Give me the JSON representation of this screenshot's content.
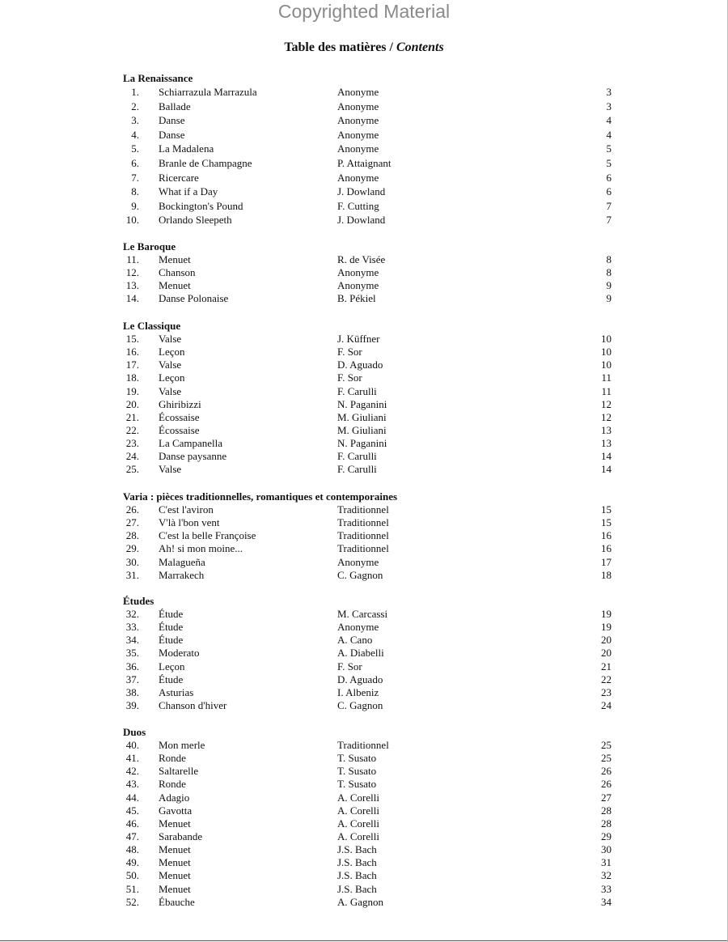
{
  "watermark": "Copyrighted Material",
  "title": {
    "main": "Table des matières / ",
    "italic": "Contents"
  },
  "sections": [
    {
      "heading": "La Renaissance",
      "items": [
        [
          "1.",
          "Schiarrazula Marrazula",
          "Anonyme",
          "3"
        ],
        [
          "2.",
          "Ballade",
          "Anonyme",
          "3"
        ],
        [
          "3.",
          "Danse",
          "Anonyme",
          "4"
        ],
        [
          "4.",
          "Danse",
          "Anonyme",
          "4"
        ],
        [
          "5.",
          "La Madalena",
          "Anonyme",
          "5"
        ],
        [
          "6.",
          "Branle de Champagne",
          "P. Attaignant",
          "5"
        ],
        [
          "7.",
          "Ricercare",
          "Anonyme",
          "6"
        ],
        [
          "8.",
          "What if a Day",
          "J. Dowland",
          "6"
        ],
        [
          "9.",
          "Bockington's Pound",
          "F. Cutting",
          "7"
        ],
        [
          "10.",
          "Orlando Sleepeth",
          "J. Dowland",
          "7"
        ]
      ]
    },
    {
      "heading": "Le Baroque",
      "items": [
        [
          "11.",
          "Menuet",
          "R. de Visée",
          "8"
        ],
        [
          "12.",
          "Chanson",
          "Anonyme",
          "8"
        ],
        [
          "13.",
          "Menuet",
          "Anonyme",
          "9"
        ],
        [
          "14.",
          "Danse Polonaise",
          "B. Pékiel",
          "9"
        ]
      ]
    },
    {
      "heading": "Le Classique",
      "items": [
        [
          "15.",
          "Valse",
          "J. Küffner",
          "10"
        ],
        [
          "16.",
          "Leçon",
          "F. Sor",
          "10"
        ],
        [
          "17.",
          "Valse",
          "D. Aguado",
          "10"
        ],
        [
          "18.",
          "Leçon",
          "F. Sor",
          "11"
        ],
        [
          "19.",
          "Valse",
          "F. Carulli",
          "11"
        ],
        [
          "20.",
          "Ghiribizzi",
          "N. Paganini",
          "12"
        ],
        [
          "21.",
          "Écossaise",
          "M. Giuliani",
          "12"
        ],
        [
          "22.",
          "Écossaise",
          "M. Giuliani",
          "13"
        ],
        [
          "23.",
          "La Campanella",
          "N. Paganini",
          "13"
        ],
        [
          "24.",
          "Danse paysanne",
          "F. Carulli",
          "14"
        ],
        [
          "25.",
          "Valse",
          "F. Carulli",
          "14"
        ]
      ]
    },
    {
      "heading": "Varia : pièces traditionnelles, romantiques et contemporaines",
      "items": [
        [
          "26.",
          "C'est l'aviron",
          "Traditionnel",
          "15"
        ],
        [
          "27.",
          "V'là l'bon vent",
          "Traditionnel",
          "15"
        ],
        [
          "28.",
          "C'est la belle Françoise",
          "Traditionnel",
          "16"
        ],
        [
          "29.",
          "Ah! si mon moine...",
          "Traditionnel",
          "16"
        ],
        [
          "30.",
          "Malagueña",
          "Anonyme",
          "17"
        ],
        [
          "31.",
          "Marrakech",
          "C. Gagnon",
          "18"
        ]
      ]
    },
    {
      "heading": "Études",
      "items": [
        [
          "32.",
          "Étude",
          "M. Carcassi",
          "19"
        ],
        [
          "33.",
          "Étude",
          "Anonyme",
          "19"
        ],
        [
          "34.",
          "Étude",
          "A. Cano",
          "20"
        ],
        [
          "35.",
          "Moderato",
          "A. Diabelli",
          "20"
        ],
        [
          "36.",
          "Leçon",
          "F. Sor",
          "21"
        ],
        [
          "37.",
          "Étude",
          "D. Aguado",
          "22"
        ],
        [
          "38.",
          "Asturias",
          "I. Albeniz",
          "23"
        ],
        [
          "39.",
          "Chanson d'hiver",
          "C. Gagnon",
          "24"
        ]
      ]
    },
    {
      "heading": "Duos",
      "items": [
        [
          "40.",
          "Mon merle",
          "Traditionnel",
          "25"
        ],
        [
          "41.",
          "Ronde",
          "T. Susato",
          "25"
        ],
        [
          "42.",
          "Saltarelle",
          "T. Susato",
          "26"
        ],
        [
          "43.",
          "Ronde",
          "T. Susato",
          "26"
        ],
        [
          "44.",
          "Adagio",
          "A. Corelli",
          "27"
        ],
        [
          "45.",
          "Gavotta",
          "A. Corelli",
          "28"
        ],
        [
          "46.",
          "Menuet",
          "A. Corelli",
          "28"
        ],
        [
          "47.",
          "Sarabande",
          "A. Corelli",
          "29"
        ],
        [
          "48.",
          "Menuet",
          "J.S. Bach",
          "30"
        ],
        [
          "49.",
          "Menuet",
          "J.S. Bach",
          "31"
        ],
        [
          "50.",
          "Menuet",
          "J.S. Bach",
          "32"
        ],
        [
          "51.",
          "Menuet",
          "J.S. Bach",
          "33"
        ],
        [
          "52.",
          "Ébauche",
          "A. Gagnon",
          "34"
        ]
      ]
    }
  ]
}
